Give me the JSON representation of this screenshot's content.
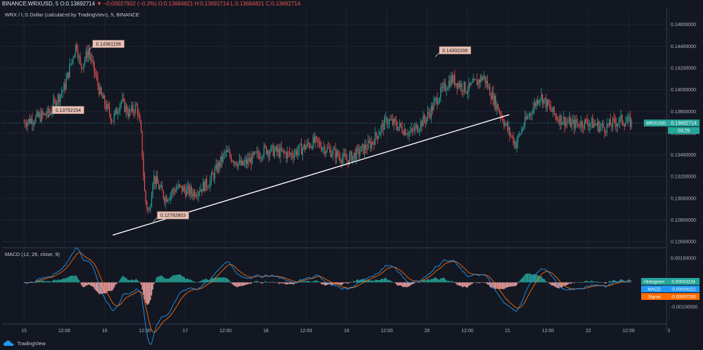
{
  "header": {
    "symbol": "BINANCE:WRXUSD, 5",
    "open_label": "O:",
    "open": "0.13692714",
    "change": "▼ −0.00027902 (−0.2%)",
    "ohlc_rest": "O:0.13684821 H:0.13692714 L:0.13684821 C:0.13692714"
  },
  "subtitle": "WRX / US Dollar (calculated by TradingView), 5, BINANCE",
  "macd_title": "MACD (12, 26, close, 9)",
  "branding": "TradingView",
  "colors": {
    "bg": "#131722",
    "up": "#26a69a",
    "down": "#ef5350",
    "grid": "#1f2433",
    "trend": "#ffffff",
    "macd": "#2196f3",
    "signal": "#ff6d00",
    "label_bg": "#e8c1b4"
  },
  "chart_data": [
    {
      "type": "candlestick",
      "ylim": [
        0.1255,
        0.1475
      ],
      "y_ticks": [
        "0.14600000",
        "0.14400000",
        "0.14200000",
        "0.14000000",
        "0.13800000",
        "0.13600000",
        "0.13400000",
        "0.13200000",
        "0.13000000",
        "0.12800000",
        "0.12600000"
      ],
      "x_ticks": [
        "15",
        "12:00",
        "16",
        "12:00",
        "17",
        "12:00",
        "18",
        "12:00",
        "19",
        "12:00",
        "20",
        "12:00",
        "21",
        "12:00",
        "22",
        "12:00",
        "2"
      ],
      "price_path": [
        [
          0.0,
          0.137
        ],
        [
          0.3,
          0.1378
        ],
        [
          0.5,
          0.1402
        ],
        [
          0.65,
          0.1443
        ],
        [
          0.7,
          0.142
        ],
        [
          0.8,
          0.1436
        ],
        [
          0.95,
          0.1395
        ],
        [
          1.1,
          0.1372
        ],
        [
          1.2,
          0.139
        ],
        [
          1.3,
          0.1378
        ],
        [
          1.4,
          0.1385
        ],
        [
          1.45,
          0.136
        ],
        [
          1.5,
          0.13
        ],
        [
          1.55,
          0.1285
        ],
        [
          1.6,
          0.132
        ],
        [
          1.75,
          0.13
        ],
        [
          1.9,
          0.131
        ],
        [
          2.1,
          0.1305
        ],
        [
          2.3,
          0.1315
        ],
        [
          2.5,
          0.1342
        ],
        [
          2.7,
          0.133
        ],
        [
          3.0,
          0.1345
        ],
        [
          3.3,
          0.134
        ],
        [
          3.6,
          0.1352
        ],
        [
          4.0,
          0.1335
        ],
        [
          4.3,
          0.135
        ],
        [
          4.5,
          0.1372
        ],
        [
          4.8,
          0.136
        ],
        [
          5.0,
          0.1375
        ],
        [
          5.15,
          0.1395
        ],
        [
          5.3,
          0.141
        ],
        [
          5.5,
          0.14
        ],
        [
          5.7,
          0.1412
        ],
        [
          5.8,
          0.1395
        ],
        [
          5.9,
          0.138
        ],
        [
          6.0,
          0.1363
        ],
        [
          6.1,
          0.135
        ],
        [
          6.2,
          0.1368
        ],
        [
          6.4,
          0.1395
        ],
        [
          6.6,
          0.1375
        ],
        [
          6.8,
          0.1368
        ],
        [
          7.0,
          0.137
        ],
        [
          7.2,
          0.1365
        ],
        [
          7.4,
          0.1372
        ],
        [
          7.55,
          0.1369
        ]
      ],
      "last_price": "0.13692714",
      "last_label": "WRXUSD",
      "countdown": "03:29",
      "annotations": [
        {
          "text": "0.14361156",
          "x": 0.8,
          "y": 0.14361156
        },
        {
          "text": "0.13752154",
          "x": 0.3,
          "y": 0.13752154
        },
        {
          "text": "0.12782803",
          "x": 1.6,
          "y": 0.12782803
        },
        {
          "text": "0.14302206",
          "x": 5.1,
          "y": 0.14302206
        }
      ],
      "trendline": [
        [
          1.1,
          0.1266
        ],
        [
          6.02,
          0.1377
        ]
      ]
    },
    {
      "type": "macd",
      "ylim": [
        -0.0016,
        0.0014
      ],
      "y_ticks": [
        "0.00100000",
        "0.00000000",
        "-0.00100000"
      ],
      "histogram": "0.00003234",
      "histogram_label": "Histogram",
      "macd": "-0.00004021",
      "macd_label": "MACD",
      "signal": "-0.00007255",
      "signal_label": "Signal"
    }
  ]
}
